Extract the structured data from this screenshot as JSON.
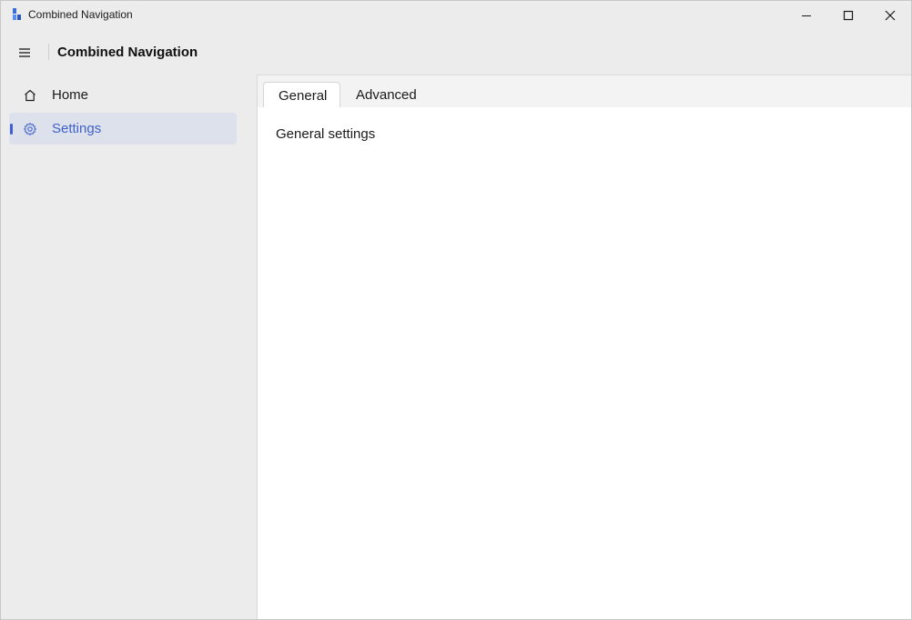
{
  "window": {
    "title": "Combined Navigation"
  },
  "header": {
    "title": "Combined Navigation"
  },
  "nav": {
    "items": [
      {
        "label": "Home",
        "icon": "home-icon",
        "selected": false
      },
      {
        "label": "Settings",
        "icon": "gear-icon",
        "selected": true
      }
    ]
  },
  "tabs": {
    "items": [
      {
        "label": "General",
        "selected": true
      },
      {
        "label": "Advanced",
        "selected": false
      }
    ],
    "content_text": "General settings"
  },
  "colors": {
    "accent": "#3f5fd4",
    "selected_nav_bg": "#dde1ec",
    "selected_nav_text": "#3f62c9",
    "window_bg": "#ececec"
  }
}
